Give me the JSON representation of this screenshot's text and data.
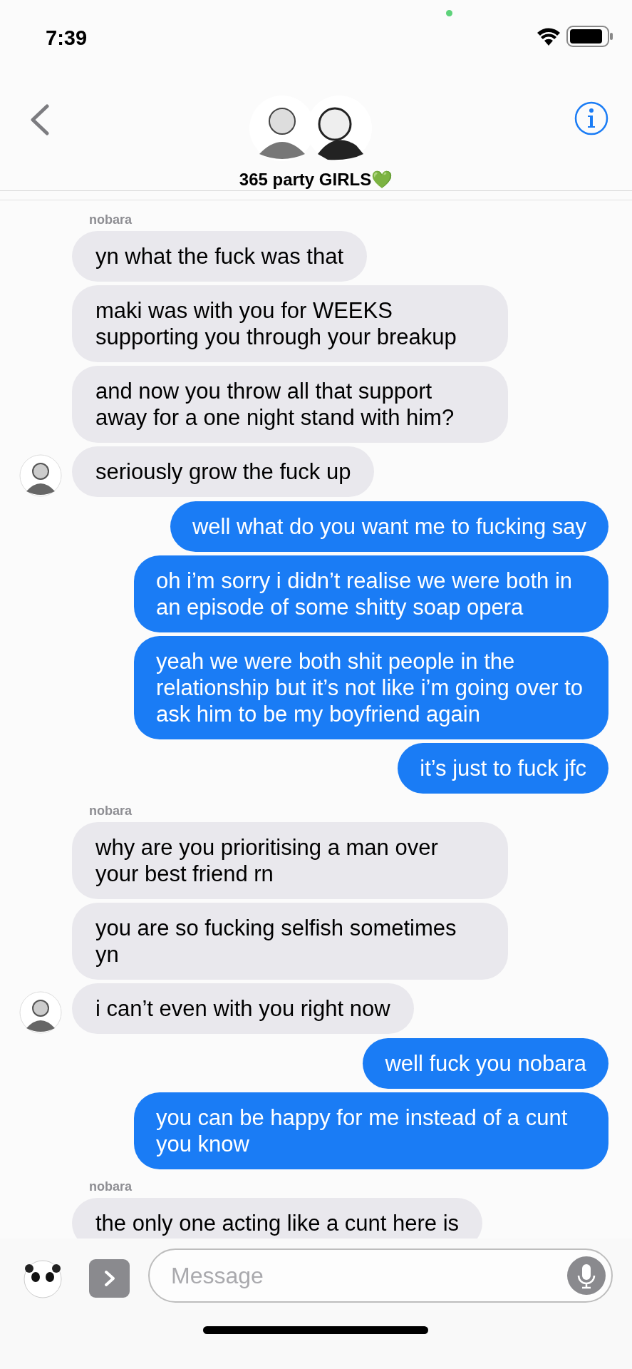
{
  "status_bar": {
    "time": "7:39"
  },
  "header": {
    "title": "365 party GIRLS💚"
  },
  "messages": [
    {
      "kind": "sender",
      "text": "nobara"
    },
    {
      "kind": "incoming",
      "text": "yn what the fuck was that",
      "avatar": false
    },
    {
      "kind": "incoming",
      "text": "maki was with you for WEEKS supporting you through your breakup",
      "avatar": false
    },
    {
      "kind": "incoming",
      "text": "and now you throw all that support away for a one night stand with him?",
      "avatar": false
    },
    {
      "kind": "incoming",
      "text": "seriously grow the fuck up",
      "avatar": true
    },
    {
      "kind": "outgoing",
      "text": "well what do you want me to fucking say"
    },
    {
      "kind": "outgoing",
      "text": "oh i’m sorry i didn’t realise we were both in an episode of some shitty soap opera"
    },
    {
      "kind": "outgoing",
      "text": "yeah we were both shit people in the relationship but it’s not like i’m going over to ask him to be my boyfriend again"
    },
    {
      "kind": "outgoing",
      "text": "it’s just to fuck jfc"
    },
    {
      "kind": "sender",
      "text": "nobara"
    },
    {
      "kind": "incoming",
      "text": "why are you prioritising a man over your best friend rn",
      "avatar": false
    },
    {
      "kind": "incoming",
      "text": "you are so fucking selfish sometimes yn",
      "avatar": false
    },
    {
      "kind": "incoming",
      "text": "i can’t even with you right now",
      "avatar": true
    },
    {
      "kind": "outgoing",
      "text": "well fuck you nobara"
    },
    {
      "kind": "outgoing",
      "text": "you can be happy for me instead of a cunt you know"
    },
    {
      "kind": "sender",
      "text": "nobara"
    },
    {
      "kind": "incoming",
      "text": "the only one acting like a cunt here is",
      "avatar": false
    }
  ],
  "composer": {
    "placeholder": "Message"
  }
}
